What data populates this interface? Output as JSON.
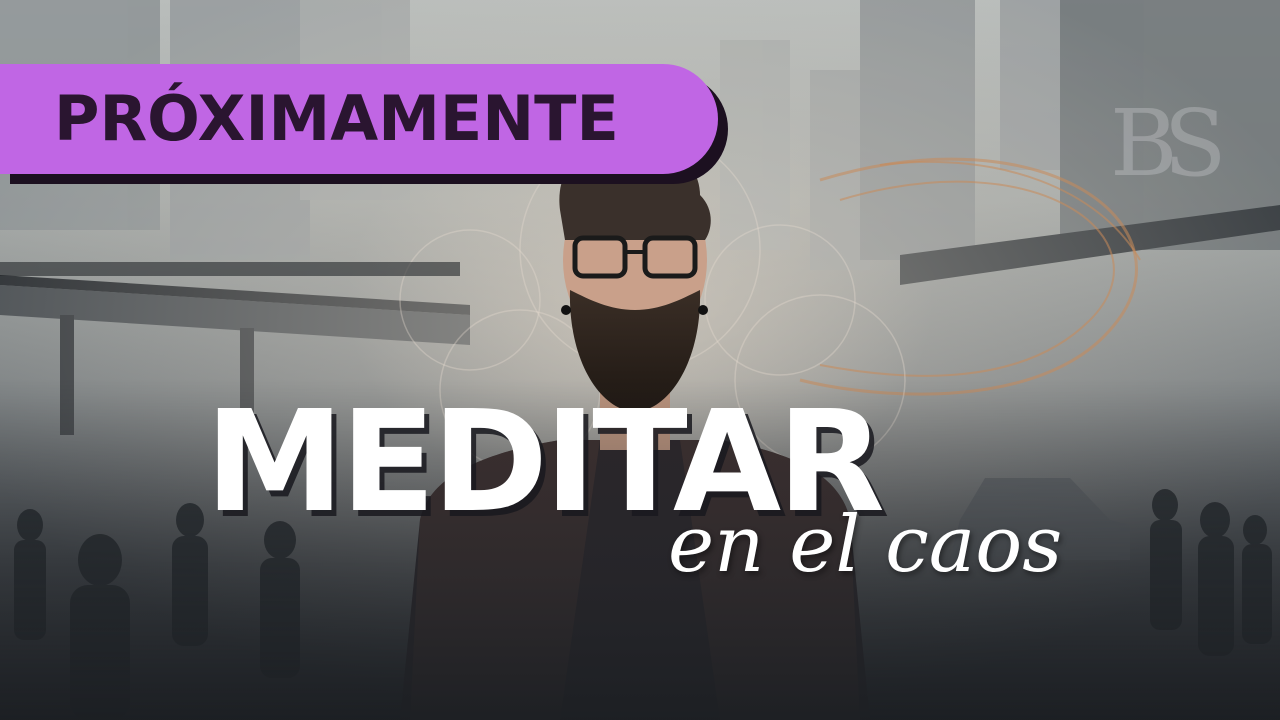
{
  "badge": {
    "label": "PRÓXIMAMENTE",
    "color": "#c066e4"
  },
  "title": "MEDITAR",
  "subtitle": "en el caos",
  "watermark": "BS"
}
